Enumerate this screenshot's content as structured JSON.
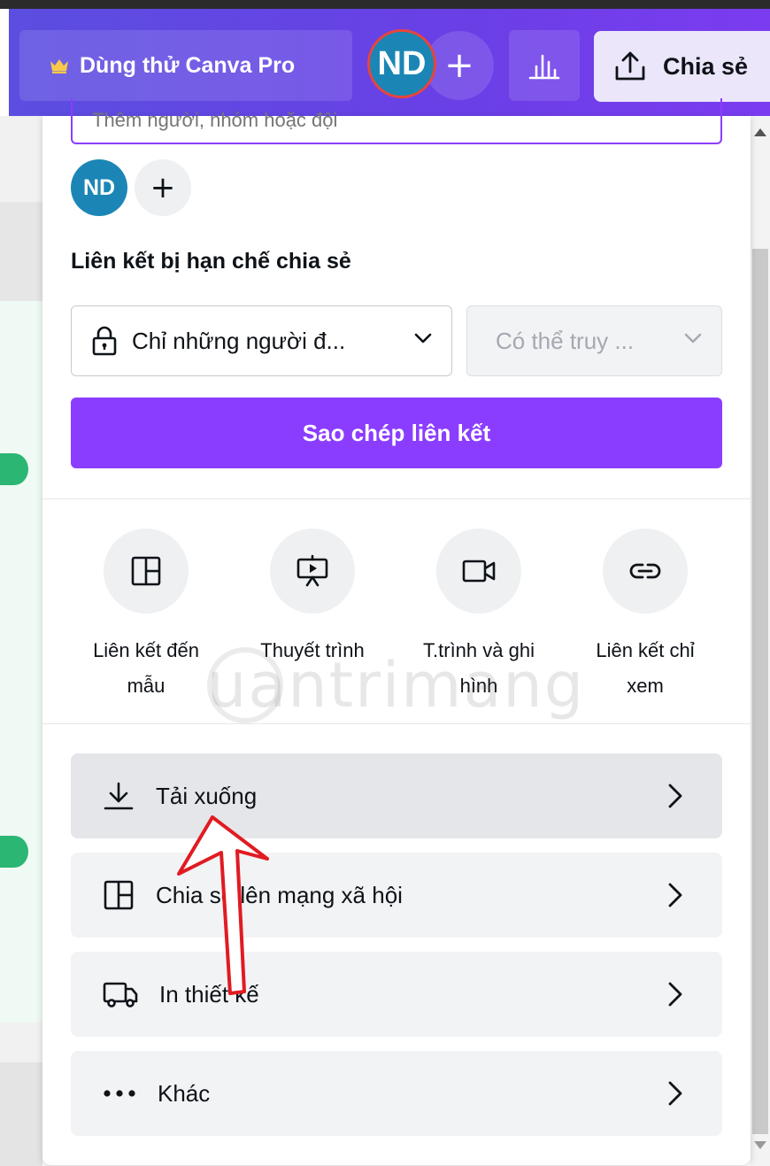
{
  "topbar": {
    "pro_label": "Dùng thử Canva Pro",
    "avatar_initials": "ND",
    "add_symbol": "+",
    "share_label": "Chia sẻ"
  },
  "panel": {
    "search_placeholder": "Thêm người, nhóm hoặc đội",
    "avatar_initials": "ND",
    "add_symbol": "+",
    "section_title": "Liên kết bị hạn chế chia sẻ",
    "access_select_value": "Chỉ những người đ...",
    "permission_select_value": "Có thể truy ...",
    "copy_link_label": "Sao chép liên kết",
    "options": [
      {
        "line1": "Liên kết đến",
        "line2": "mẫu"
      },
      {
        "line1": "Thuyết trình",
        "line2": ""
      },
      {
        "line1": "T.trình và ghi",
        "line2": "hình"
      },
      {
        "line1": "Liên kết chỉ",
        "line2": "xem"
      }
    ],
    "rows": [
      {
        "label": "Tải xuống"
      },
      {
        "label": "Chia sẻ lên mạng xã hội"
      },
      {
        "label": "In thiết kế"
      },
      {
        "label": "Khác"
      }
    ]
  },
  "watermark": "uantrimang",
  "colors": {
    "topbar_gradient_start": "#5b4ee0",
    "topbar_gradient_end": "#7b3cf0",
    "accent_purple": "#8b3dff",
    "avatar_blue": "#1b86b5",
    "annotation_red": "#e11b22"
  },
  "icons": {
    "pro": "crown-icon",
    "insights": "bar-chart-icon",
    "share": "upload-icon",
    "access": "lock-icon",
    "template": "layout-icon",
    "present": "presentation-icon",
    "record": "video-camera-icon",
    "view_link": "link-icon",
    "download": "download-icon",
    "social": "layout-icon",
    "print": "truck-icon",
    "more": "more-horizontal-icon"
  }
}
